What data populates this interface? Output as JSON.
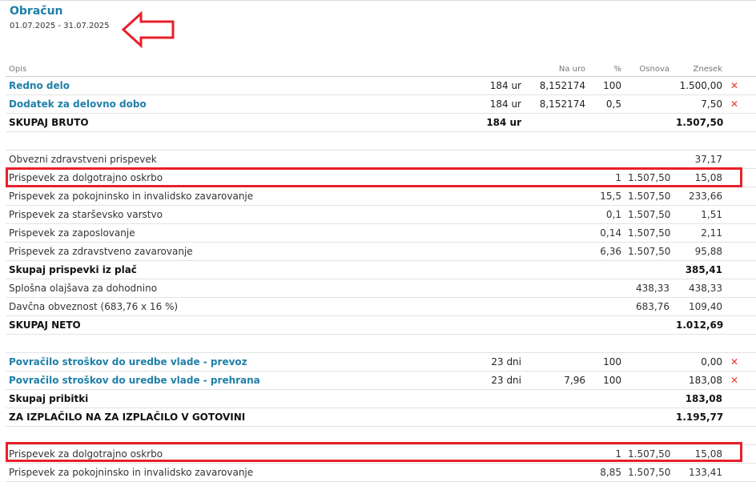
{
  "header": {
    "title": "Obračun",
    "period": "01.07.2025 - 31.07.2025"
  },
  "columns": {
    "desc": "Opis",
    "rate": "Na uro",
    "pct": "%",
    "base": "Osnova",
    "amount": "Znesek"
  },
  "rows": [
    {
      "desc": "Redno delo",
      "qty": "184 ur",
      "rate": "8,152174",
      "pct": "100",
      "base": "",
      "amount": "1.500,00",
      "x": "✕"
    },
    {
      "desc": "Dodatek za delovno dobo",
      "qty": "184 ur",
      "rate": "8,152174",
      "pct": "0,5",
      "base": "",
      "amount": "7,50",
      "x": "✕"
    },
    {
      "desc": "SKUPAJ BRUTO",
      "qty": "184 ur",
      "rate": "",
      "pct": "",
      "base": "",
      "amount": "1.507,50"
    },
    {
      "desc": "Obvezni zdravstveni prispevek",
      "qty": "",
      "rate": "",
      "pct": "",
      "base": "",
      "amount": "37,17"
    },
    {
      "desc": "Prispevek za dolgotrajno oskrbo",
      "qty": "",
      "rate": "",
      "pct": "1",
      "base": "1.507,50",
      "amount": "15,08"
    },
    {
      "desc": "Prispevek za pokojninsko in invalidsko zavarovanje",
      "qty": "",
      "rate": "",
      "pct": "15,5",
      "base": "1.507,50",
      "amount": "233,66"
    },
    {
      "desc": "Prispevek za starševsko varstvo",
      "qty": "",
      "rate": "",
      "pct": "0,1",
      "base": "1.507,50",
      "amount": "1,51"
    },
    {
      "desc": "Prispevek za zaposlovanje",
      "qty": "",
      "rate": "",
      "pct": "0,14",
      "base": "1.507,50",
      "amount": "2,11"
    },
    {
      "desc": "Prispevek za zdravstveno zavarovanje",
      "qty": "",
      "rate": "",
      "pct": "6,36",
      "base": "1.507,50",
      "amount": "95,88"
    },
    {
      "desc": "Skupaj prispevki iz plač",
      "qty": "",
      "rate": "",
      "pct": "",
      "base": "",
      "amount": "385,41"
    },
    {
      "desc": "Splošna olajšava za dohodnino",
      "qty": "",
      "rate": "",
      "pct": "",
      "base": "438,33",
      "amount": "438,33"
    },
    {
      "desc": "Davčna obveznost (683,76 x 16 %)",
      "qty": "",
      "rate": "",
      "pct": "",
      "base": "683,76",
      "amount": "109,40"
    },
    {
      "desc": "SKUPAJ NETO",
      "qty": "",
      "rate": "",
      "pct": "",
      "base": "",
      "amount": "1.012,69"
    },
    {
      "desc": "Povračilo stroškov do uredbe vlade - prevoz",
      "qty": "23 dni",
      "rate": "",
      "pct": "100",
      "base": "",
      "amount": "0,00",
      "x": "✕"
    },
    {
      "desc": "Povračilo stroškov do uredbe vlade - prehrana",
      "qty": "23 dni",
      "rate": "7,96",
      "pct": "100",
      "base": "",
      "amount": "183,08",
      "x": "✕"
    },
    {
      "desc": "Skupaj pribitki",
      "qty": "",
      "rate": "",
      "pct": "",
      "base": "",
      "amount": "183,08"
    },
    {
      "desc": "ZA IZPLAČILO NA ZA IZPLAČILO V GOTOVINI",
      "qty": "",
      "rate": "",
      "pct": "",
      "base": "",
      "amount": "1.195,77"
    },
    {
      "desc": "Prispevek za dolgotrajno oskrbo",
      "qty": "",
      "rate": "",
      "pct": "1",
      "base": "1.507,50",
      "amount": "15,08"
    },
    {
      "desc": "Prispevek za pokojninsko in invalidsko zavarovanje",
      "qty": "",
      "rate": "",
      "pct": "8,85",
      "base": "1.507,50",
      "amount": "133,41"
    }
  ],
  "annotations": {
    "highlight_color": "#e8202a",
    "arrow": "arrow-left-icon"
  },
  "colors": {
    "accent": "#1f7fa8",
    "delete": "#e53a2a"
  }
}
